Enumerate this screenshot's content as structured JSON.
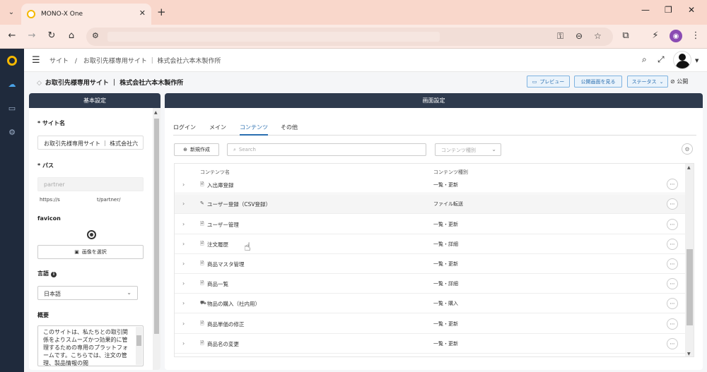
{
  "browser": {
    "tab_title": "MONO-X One",
    "tab_dropdown": "⌄",
    "tab_close": "✕",
    "new_tab": "+",
    "win_min": "—",
    "win_restore": "❐",
    "win_close": "✕"
  },
  "header": {
    "breadcrumb": [
      "サイト",
      "/",
      "お取引先様専用サイト ｜ 株式会社六本木製作所"
    ]
  },
  "subheader": {
    "title": "お取引先様専用サイト ｜ 株式会社六本木製作所",
    "preview_label": "プレビュー",
    "view_public_label": "公開画面を見る",
    "status_label": "ステータス",
    "publish_label": "公開"
  },
  "left_panel": {
    "heading": "基本設定",
    "site_name_label": "サイト名",
    "site_name_value": "お取引先様専用サイト ｜ 株式会社六",
    "path_label": "パス",
    "path_placeholder": "partner",
    "url_prefix": "https://s",
    "url_suffix": "t/partner/",
    "favicon_label": "favicon",
    "select_image_label": "画像を選択",
    "language_label": "言語",
    "language_value": "日本語",
    "summary_label": "概要",
    "summary_text": "このサイトは、私たちとの取引関係をよりスムーズかつ効果的に管理するための専用のプラットフォームです。こちらでは、注文の管理、製品情報の閲"
  },
  "right_panel": {
    "heading": "画面設定",
    "tabs": [
      "ログイン",
      "メイン",
      "コンテンツ",
      "その他"
    ],
    "active_tab": 2,
    "new_button": "新規作成",
    "search_placeholder": "Search",
    "type_select_placeholder": "コンテンツ種別",
    "columns": [
      "コンテンツ名",
      "コンテンツ種別"
    ],
    "rows": [
      {
        "name": "入出庫登録",
        "type": "一覧・更新",
        "icon": "doc-icon"
      },
      {
        "name": "ユーザー登録（CSV登録）",
        "type": "ファイル転送",
        "icon": "edit-icon"
      },
      {
        "name": "ユーザー管理",
        "type": "一覧・更新",
        "icon": "doc-icon"
      },
      {
        "name": "注文履歴",
        "type": "一覧・詳細",
        "icon": "doc-icon"
      },
      {
        "name": "商品マスタ管理",
        "type": "一覧・更新",
        "icon": "doc-icon"
      },
      {
        "name": "商品一覧",
        "type": "一覧・詳細",
        "icon": "doc-icon"
      },
      {
        "name": "物品の購入（社内用）",
        "type": "一覧・購入",
        "icon": "cart-icon"
      },
      {
        "name": "商品単価の修正",
        "type": "一覧・更新",
        "icon": "doc-icon"
      },
      {
        "name": "商品名の変更",
        "type": "一覧・更新",
        "icon": "doc-icon"
      }
    ]
  },
  "colors": {
    "rail": "#1f2a3c",
    "panel_header": "#2e3a4d",
    "accent": "#2a6fb0",
    "tab_bar": "#f9d7cb",
    "logo": "#f5b800"
  }
}
